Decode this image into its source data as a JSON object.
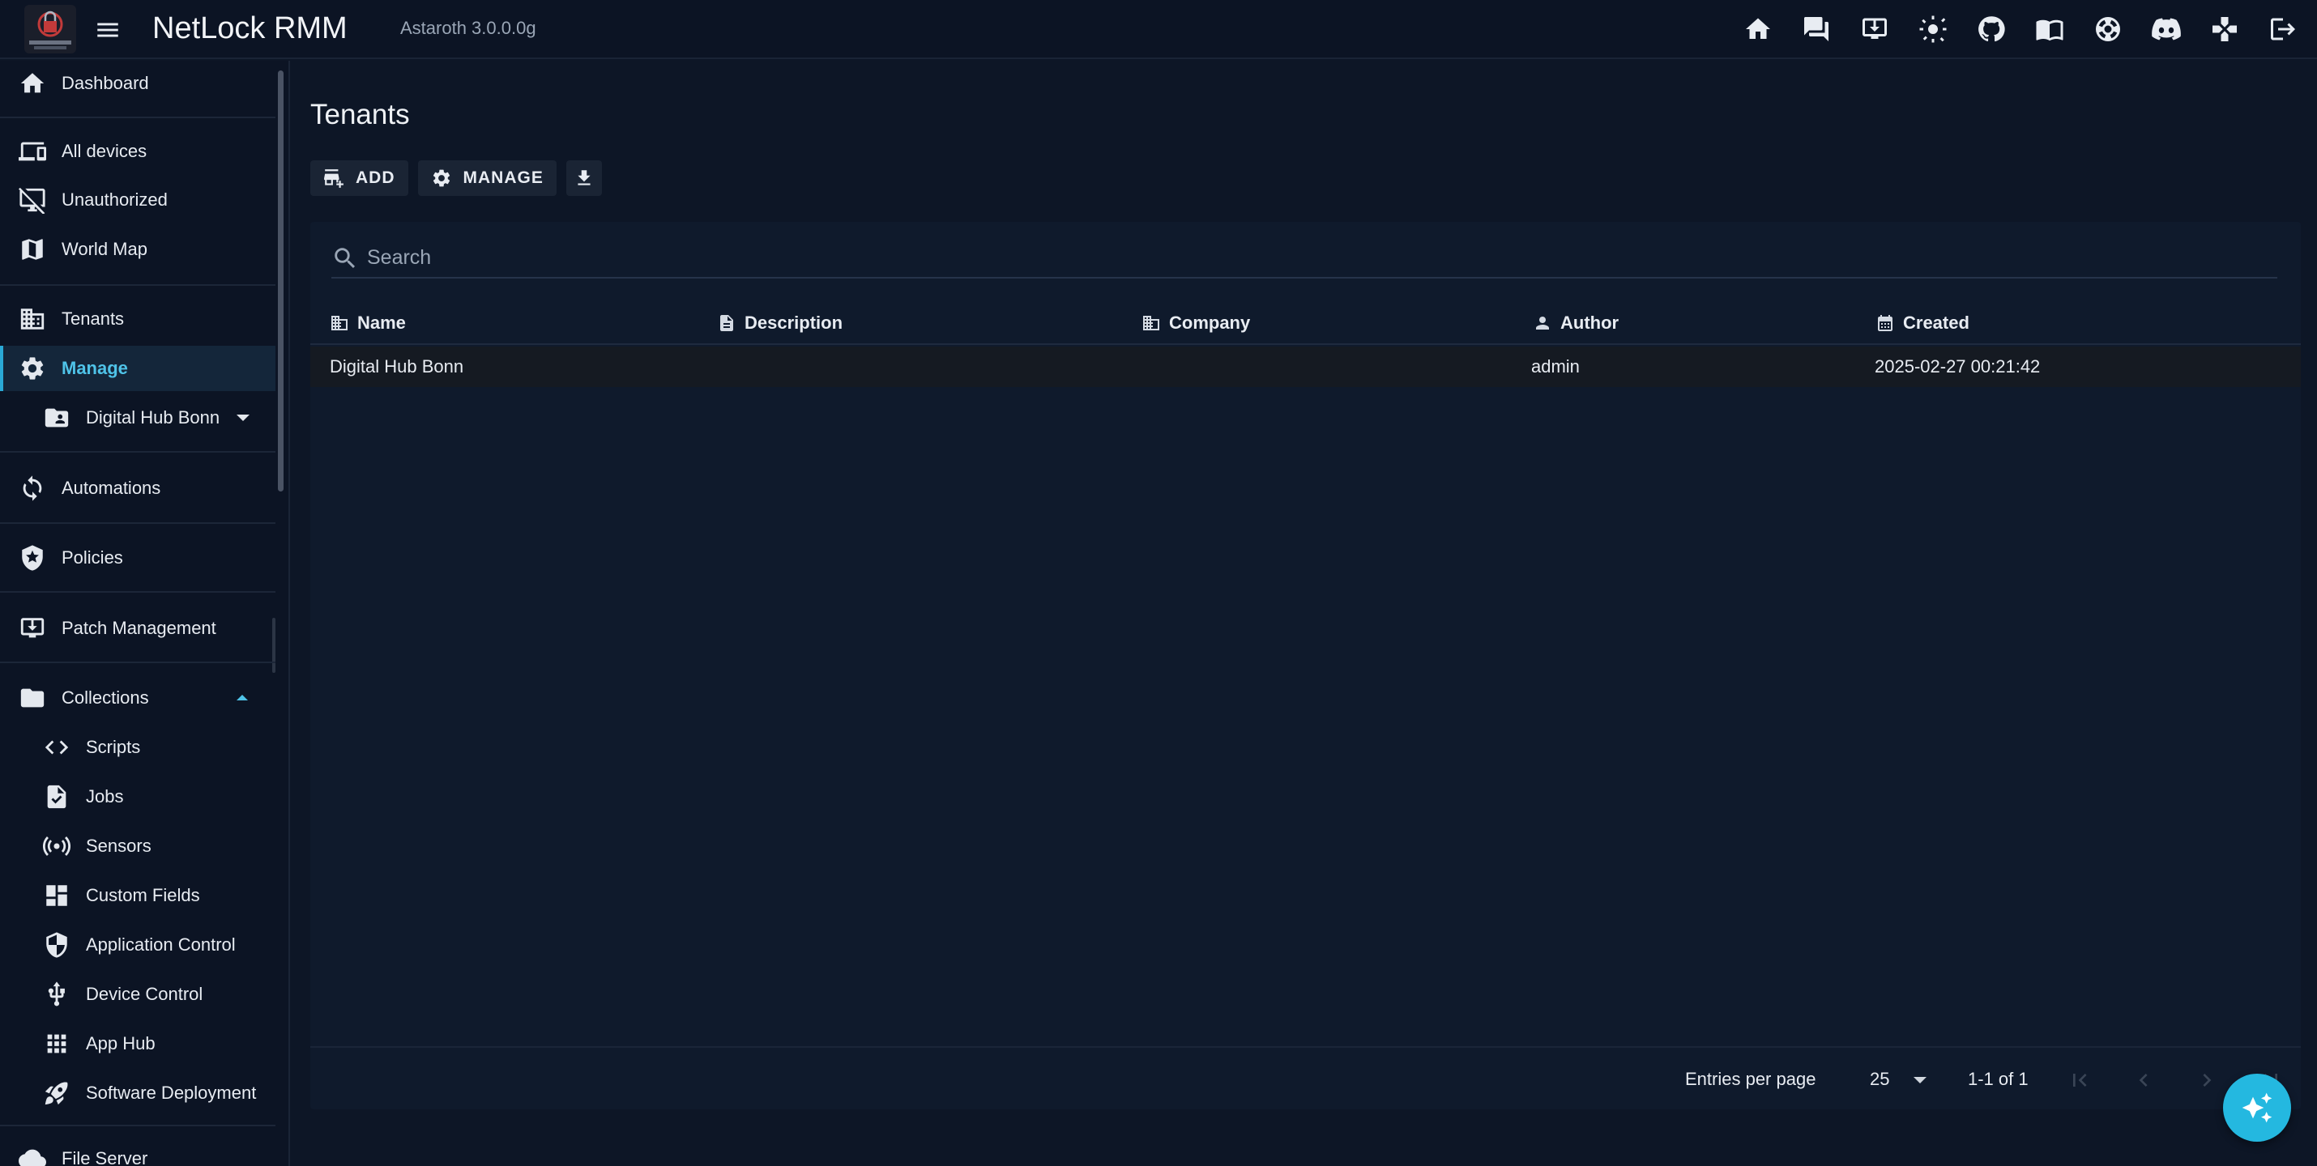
{
  "app": {
    "title": "NetLock RMM",
    "version": "Astaroth 3.0.0.0g",
    "logo_text": "NETLOCK RMM"
  },
  "topbar": {
    "icons": [
      "home-icon",
      "chat-icon",
      "download-icon",
      "brightness-icon",
      "github-icon",
      "documentation-icon",
      "support-icon",
      "discord-icon",
      "gamepad-icon",
      "logout-icon"
    ]
  },
  "sidebar": {
    "items": [
      {
        "label": "Dashboard",
        "icon": "home-icon"
      },
      {
        "label": "All devices",
        "icon": "devices-icon"
      },
      {
        "label": "Unauthorized",
        "icon": "desktop-off-icon"
      },
      {
        "label": "World Map",
        "icon": "map-icon"
      },
      {
        "label": "Tenants",
        "icon": "building-icon"
      },
      {
        "label": "Manage",
        "icon": "gear-icon"
      },
      {
        "label": "Digital Hub Bonn",
        "icon": "folder-account-icon"
      },
      {
        "label": "Automations",
        "icon": "automation-icon"
      },
      {
        "label": "Policies",
        "icon": "policy-shield-icon"
      },
      {
        "label": "Patch Management",
        "icon": "patch-download-icon"
      },
      {
        "label": "Collections",
        "icon": "folder-icon"
      },
      {
        "label": "Scripts",
        "icon": "code-icon"
      },
      {
        "label": "Jobs",
        "icon": "job-file-icon"
      },
      {
        "label": "Sensors",
        "icon": "sensor-icon"
      },
      {
        "label": "Custom Fields",
        "icon": "dashboard-grid-icon"
      },
      {
        "label": "Application Control",
        "icon": "shield-icon"
      },
      {
        "label": "Device Control",
        "icon": "usb-icon"
      },
      {
        "label": "App Hub",
        "icon": "apps-icon"
      },
      {
        "label": "Software Deployment",
        "icon": "rocket-icon"
      },
      {
        "label": "File Server",
        "icon": "cloud-icon"
      }
    ]
  },
  "main": {
    "title": "Tenants",
    "toolbar": {
      "add_label": "ADD",
      "manage_label": "MANAGE"
    },
    "search": {
      "placeholder": "Search",
      "value": ""
    },
    "table": {
      "columns": [
        "Name",
        "Description",
        "Company",
        "Author",
        "Created"
      ],
      "rows": [
        {
          "name": "Digital Hub Bonn",
          "description": "",
          "company": "",
          "author": "admin",
          "created": "2025-02-27 00:21:42"
        }
      ]
    },
    "pagination": {
      "entries_label": "Entries per page",
      "per_page": "25",
      "range": "1-1 of 1"
    }
  },
  "colors": {
    "background": "#0d1626",
    "panel": "#0f1a2c",
    "accent": "#4fc3e8",
    "fab": "#24b8e0"
  }
}
